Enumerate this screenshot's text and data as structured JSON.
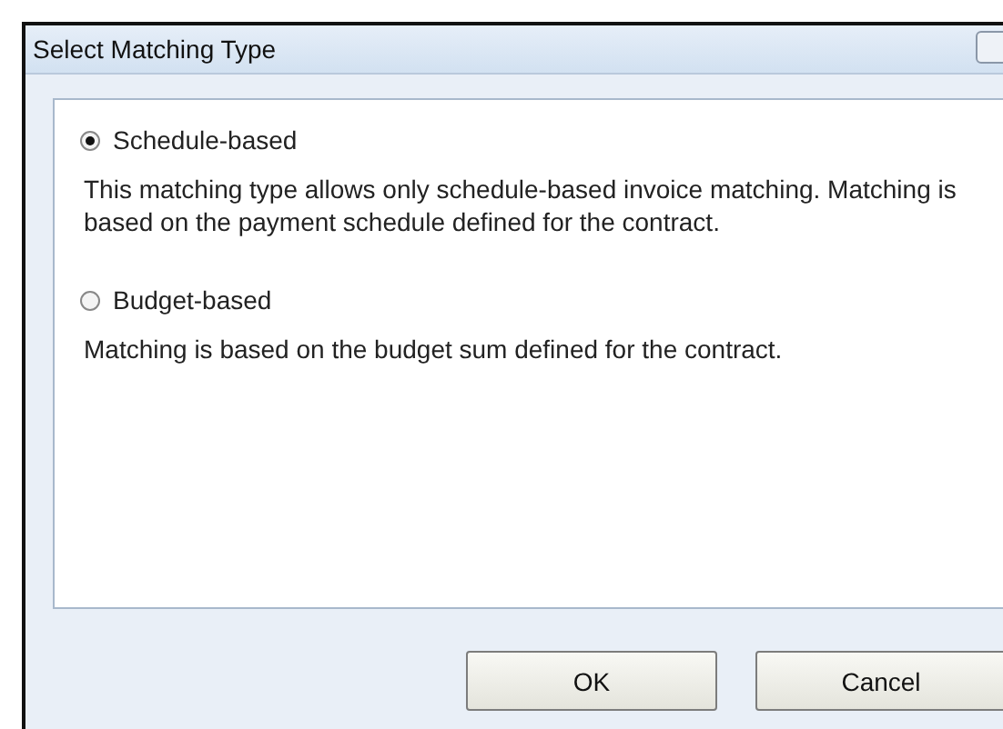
{
  "window": {
    "title": "Select Matching Type"
  },
  "options": [
    {
      "label": "Schedule-based",
      "selected": true,
      "description": "This matching type allows only schedule-based invoice matching. Matching is based on the payment schedule defined for the contract."
    },
    {
      "label": "Budget-based",
      "selected": false,
      "description": "Matching is based on the budget sum defined for the contract."
    }
  ],
  "buttons": [
    "OK",
    "Cancel"
  ]
}
